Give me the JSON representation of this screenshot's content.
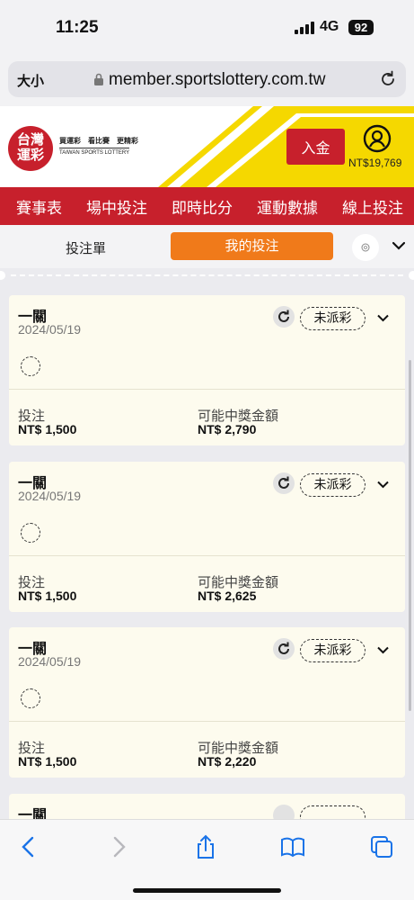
{
  "status_bar": {
    "time": "11:25",
    "network": "4G",
    "battery": "92"
  },
  "browser": {
    "text_size": "大小",
    "url": "member.sportslottery.com.tw"
  },
  "site": {
    "logo_main": "台灣運彩",
    "logo_slogan": "買運彩　看比賽　更精彩",
    "logo_en": "TAIWAN SPORTS LOTTERY",
    "deposit_label": "入金",
    "balance": "NT$19,769"
  },
  "nav": {
    "items": [
      "賽事表",
      "場中投注",
      "即時比分",
      "運動數據",
      "線上投注"
    ]
  },
  "tabs": {
    "bet_slip": "投注單",
    "my_bets": "我的投注"
  },
  "bets": [
    {
      "type": "一關",
      "date": "2024/05/19",
      "status": "未派彩",
      "stake_label": "投注",
      "stake": "NT$ 1,500",
      "prize_label": "可能中獎金額",
      "prize": "NT$ 2,790"
    },
    {
      "type": "一關",
      "date": "2024/05/19",
      "status": "未派彩",
      "stake_label": "投注",
      "stake": "NT$ 1,500",
      "prize_label": "可能中獎金額",
      "prize": "NT$ 2,625"
    },
    {
      "type": "一關",
      "date": "2024/05/19",
      "status": "未派彩",
      "stake_label": "投注",
      "stake": "NT$ 1,500",
      "prize_label": "可能中獎金額",
      "prize": "NT$ 2,220"
    },
    {
      "type": "一關",
      "date": "",
      "status": "",
      "stake_label": "",
      "stake": "",
      "prize_label": "",
      "prize": ""
    }
  ],
  "colors": {
    "brand_red": "#c7202c",
    "accent_orange": "#f07a1a",
    "brand_yellow": "#f5d800",
    "card_bg": "#fdfbee"
  }
}
